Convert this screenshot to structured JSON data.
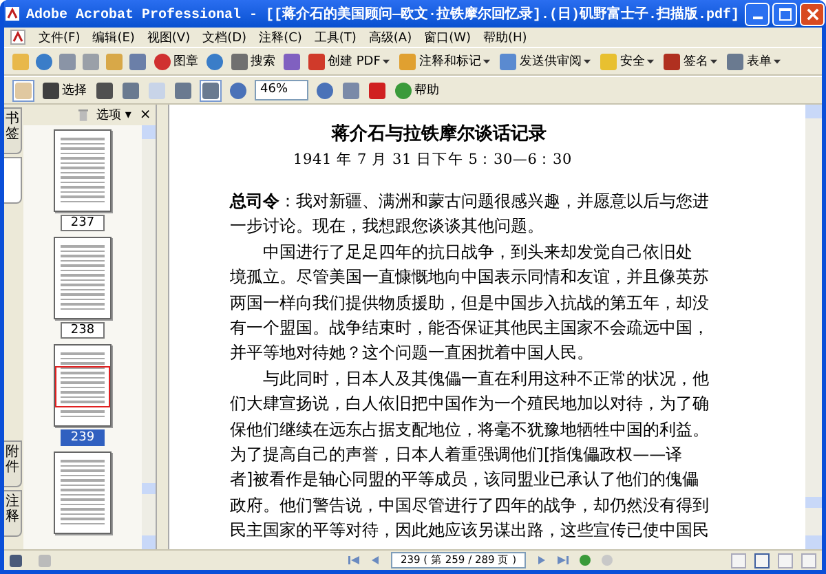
{
  "window": {
    "title": "Adobe Acrobat Professional - [[蒋介石的美国顾问—欧文·拉铁摩尔回忆录].(日)矶野富士子.扫描版.pdf]"
  },
  "menu": [
    "文件(F)",
    "编辑(E)",
    "视图(V)",
    "文档(D)",
    "注释(C)",
    "工具(T)",
    "高级(A)",
    "窗口(W)",
    "帮助(H)"
  ],
  "toolbar1": [
    {
      "kind": "icon"
    },
    {
      "kind": "icon"
    },
    {
      "kind": "icon"
    },
    {
      "kind": "icon"
    },
    {
      "kind": "icon"
    },
    {
      "kind": "icon"
    },
    {
      "kind": "labeled",
      "label": "图章"
    },
    {
      "kind": "icon"
    },
    {
      "kind": "labeled",
      "label": "搜索"
    },
    {
      "kind": "icon"
    },
    {
      "kind": "menu",
      "label": "创建 PDF"
    },
    {
      "kind": "menu",
      "label": "注释和标记"
    },
    {
      "kind": "menu",
      "label": "发送供审阅"
    },
    {
      "kind": "menu",
      "label": "安全"
    },
    {
      "kind": "menu",
      "label": "签名"
    },
    {
      "kind": "menu",
      "label": "表单"
    }
  ],
  "toolbar2": [
    {
      "kind": "icon",
      "selected": true
    },
    {
      "kind": "labeled",
      "label": "选择",
      "selected": false
    },
    {
      "kind": "icon",
      "selected": false
    },
    {
      "kind": "icon",
      "selected": false
    },
    {
      "kind": "icon",
      "selected": false
    },
    {
      "kind": "icon",
      "selected": false
    },
    {
      "kind": "icon",
      "selected": true
    },
    {
      "kind": "icon",
      "selected": false
    },
    {
      "kind": "zoomfield",
      "value": "46%",
      "selected": false
    },
    {
      "kind": "icon",
      "selected": false
    },
    {
      "kind": "icon",
      "selected": false
    },
    {
      "kind": "icon",
      "selected": false
    },
    {
      "kind": "labeled",
      "label": "帮助",
      "selected": false
    }
  ],
  "side_tabs": [
    {
      "label": "书签",
      "selected": false
    },
    {
      "selected": true
    },
    {
      "label": "附件",
      "selected": false
    },
    {
      "label": "注释",
      "selected": false
    }
  ],
  "panel": {
    "options": "选项 ▾",
    "close": "×"
  },
  "thumbnails": [
    {
      "label": "237",
      "selected": false
    },
    {
      "label": "238",
      "selected": false
    },
    {
      "label": "239",
      "selected": true
    },
    {
      "selected": false
    }
  ],
  "document": {
    "title": "蒋介石与拉铁摩尔谈话记录",
    "date": "1941 年 7 月 31 日下午 5：30—6：30",
    "lines": [
      {
        "text": "**总司令**：我对新疆、满洲和蒙古问题很感兴趣，并愿意以后与您进",
        "kind": "plain"
      },
      {
        "text": "一步讨论。现在，我想跟您谈谈其他问题。",
        "kind": "plain"
      },
      {
        "text": "中国进行了足足四年的抗日战争，到头来却发觉自己依旧处",
        "kind": "indented"
      },
      {
        "text": "境孤立。尽管美国一直慷慨地向中国表示同情和友谊，并且像英苏",
        "kind": "plain"
      },
      {
        "text": "两国一样向我们提供物质援助，但是中国步入抗战的第五年，却没",
        "kind": "plain"
      },
      {
        "text": "有一个盟国。战争结束时，能否保证其他民主国家不会疏远中国，",
        "kind": "plain"
      },
      {
        "text": "并平等地对待她？这个问题一直困扰着中国人民。",
        "kind": "plain"
      },
      {
        "text": "与此同时，日本人及其傀儡一直在利用这种不正常的状况，他",
        "kind": "indented"
      },
      {
        "text": "们大肆宣扬说，白人依旧把中国作为一个殖民地加以对待，为了确",
        "kind": "plain"
      },
      {
        "text": "保他们继续在远东占据支配地位，将毫不犹豫地牺牲中国的利益。",
        "kind": "plain"
      },
      {
        "text": "为了提高自己的声誉，日本人着重强调他们[指傀儡政权——译",
        "kind": "plain"
      },
      {
        "text": "者]被看作是轴心同盟的平等成员，该同盟业已承认了他们的傀儡",
        "kind": "plain"
      },
      {
        "text": "政府。他们警告说，中国尽管进行了四年的战争，却仍然没有得到",
        "kind": "plain"
      },
      {
        "text": "民主国家的平等对待，因此她应该另谋出路，这些宣传已使中国民",
        "kind": "plain"
      }
    ]
  },
  "status": {
    "page_field": "239 ( 第 259 / 289 页 )"
  }
}
